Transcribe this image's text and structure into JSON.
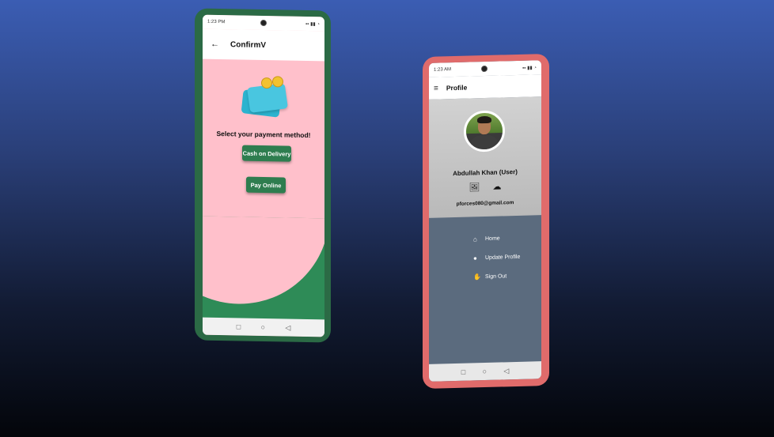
{
  "left_phone": {
    "status_time": "1:23 PM",
    "app_title": "ConfirmV",
    "prompt": "Select your payment method!",
    "buttons": {
      "cash_on_delivery": "Cash on Delivery",
      "pay_online": "Pay Online"
    },
    "icons": {
      "back": "back-arrow-icon",
      "illustration": "payment-cards-icon"
    },
    "colors": {
      "frame": "#2b6a45",
      "background": "#ffc0cb",
      "accent": "#2e8b57",
      "button": "#2e7d4f"
    }
  },
  "right_phone": {
    "status_time": "1:23 AM",
    "app_title": "Profile",
    "user_name": "Abdullah Khan (User)",
    "email": "pforces080@gmail.com",
    "menu": [
      {
        "label": "Home",
        "icon": "home-icon"
      },
      {
        "label": "Update Profile",
        "icon": "user-icon"
      },
      {
        "label": "Sign Out",
        "icon": "sign-out-icon"
      }
    ],
    "colors": {
      "frame": "#e06b6b",
      "header": "#c4c4c4",
      "drawer": "#5b6b7e"
    }
  },
  "nav_icons": [
    "square-icon",
    "circle-icon",
    "triangle-back-icon"
  ]
}
